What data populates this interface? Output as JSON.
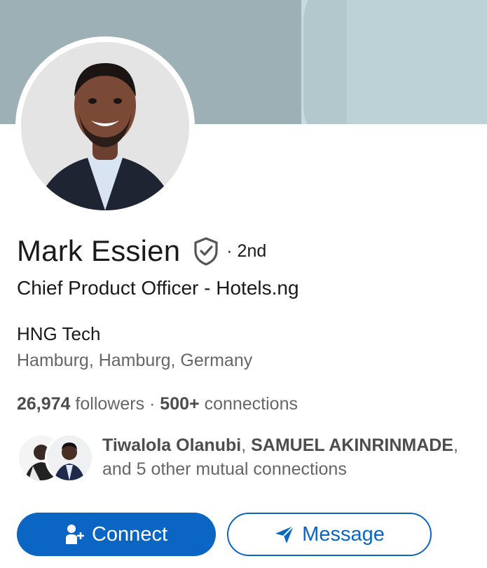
{
  "profile": {
    "name": "Mark Essien",
    "verified_icon": "shield-check-icon",
    "degree": "· 2nd",
    "headline": "Chief Product Officer - Hotels.ng",
    "company": "HNG Tech",
    "location": "Hamburg, Hamburg, Germany"
  },
  "stats": {
    "followers_count": "26,974",
    "followers_label": "followers",
    "separator": " · ",
    "connections_count": "500+",
    "connections_label": "connections"
  },
  "mutual": {
    "names": "Tiwalola Olanubi",
    "comma": ", ",
    "names2": "SAMUEL AKINRINMADE",
    "rest": ",",
    "others": "and 5 other mutual connections"
  },
  "actions": {
    "connect_label": "Connect",
    "message_label": "Message",
    "more_icon": "more-horizontal-icon"
  },
  "colors": {
    "primary": "#0a66c2",
    "banner": "#9db0b5"
  }
}
